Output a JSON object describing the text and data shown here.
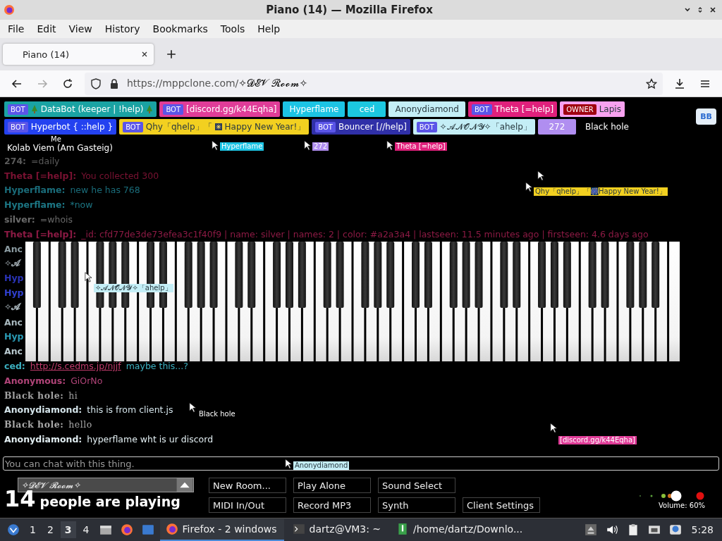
{
  "window": {
    "title": "Piano (14) — Mozilla Firefox"
  },
  "menu": [
    "File",
    "Edit",
    "View",
    "History",
    "Bookmarks",
    "Tools",
    "Help"
  ],
  "tabs": [
    {
      "label": "Piano (14)",
      "selected": true
    }
  ],
  "address": {
    "host": "https://mppclone.com/",
    "path": "✧𝓓𝓔𝓥 𝓡𝓸𝓸𝓶✧"
  },
  "player_rows": [
    [
      {
        "kind": "bot",
        "badge": "BOT",
        "parts": [
          {
            "kind": "tree"
          },
          {
            "kind": "text",
            "text": "DataBot (keeper | !help)"
          },
          {
            "kind": "tree"
          }
        ],
        "color": "#1aa3a3"
      },
      {
        "kind": "bot",
        "badge": "BOT",
        "name": "[discord.gg/k44Eqha]",
        "color": "#e03c98"
      },
      {
        "kind": "plain",
        "name": "Hyperflame",
        "color": "#1cc4e4"
      },
      {
        "kind": "plain",
        "name": "ced",
        "color": "#1cc8e0"
      },
      {
        "kind": "plain",
        "name": "Anonydiamond",
        "color": "#c4eef6"
      },
      {
        "kind": "bot",
        "badge": "BOT",
        "name": "Theta [=help]",
        "color": "#e0207c"
      },
      {
        "kind": "owner",
        "badge": "OWNER",
        "name": "Lapis",
        "color": "#f8a2f0"
      }
    ],
    [
      {
        "kind": "bot",
        "badge": "BOT",
        "name": "Hyperbot { ::help }",
        "color": "#2442f0"
      },
      {
        "kind": "bot",
        "badge": "BOT",
        "parts": [
          {
            "kind": "text",
            "text": "Qhy「qhelp」「"
          },
          {
            "kind": "firework"
          },
          {
            "kind": "text",
            "text": "Happy New Year!」"
          }
        ],
        "color": "#f2d020"
      },
      {
        "kind": "bot",
        "badge": "BOT",
        "name": "Bouncer [//help]",
        "color": "#3030a8"
      },
      {
        "kind": "bot",
        "badge": "BOT",
        "name": "✧𝓐𝓝𝓞𝓝𝓨✧「ahelp」",
        "color": "#c4eef6"
      },
      {
        "kind": "plain",
        "name": "272",
        "color": "#b08ef0"
      },
      {
        "kind": "plain",
        "name": "Black hole",
        "color": "#000000"
      }
    ]
  ],
  "corner_badge": "BB",
  "status_text": "Kolab Viem (Am Gasteig)",
  "chat": [
    {
      "kind": "normal",
      "name": "274:",
      "text": "=daily",
      "color": "#5a5a5a"
    },
    {
      "kind": "normal",
      "name": "Theta [=help]:",
      "text": "You collected 300",
      "color": "#7a1232"
    },
    {
      "kind": "normal",
      "name": "Hyperflame:",
      "text": "new he has 768",
      "color": "#1a6c7a"
    },
    {
      "kind": "normal",
      "name": "Hyperflame:",
      "text": "*now",
      "color": "#1c7684"
    },
    {
      "kind": "normal",
      "name": "silver:",
      "text": "=whois",
      "color": "#6a6a6a"
    },
    {
      "kind": "normal",
      "name": "Theta [=help]:",
      "text": "_id: cfd77de3de73efea3c1f40f9 | name: silver | names: 2 | color: #a2a3a4 | lastseen: 11.5 minutes ago | firstseen: 4.6 days ago",
      "color": "#8c1a44"
    },
    {
      "kind": "normal",
      "name": "Anc",
      "color": "#8a9aa0"
    },
    {
      "kind": "normal",
      "name": "✧𝓐",
      "color": "#9aa4aa"
    },
    {
      "kind": "normal",
      "name": "Hyp",
      "color": "#2a34b8"
    },
    {
      "kind": "normal",
      "name": "Hyp",
      "color": "#3040d0"
    },
    {
      "kind": "normal",
      "name": "✧𝓐",
      "color": "#a8b4ba"
    },
    {
      "kind": "normal",
      "name": "Anc",
      "color": "#a8b8be"
    },
    {
      "kind": "normal",
      "name": "Hyp",
      "color": "#2a9ab4"
    },
    {
      "kind": "normal",
      "name": "Anc",
      "color": "#b8c8ce"
    },
    {
      "kind": "normal",
      "name": "ced:",
      "link": "http://s.cedms.jp/njjf",
      "text": "maybe this...?",
      "color": "#3cb0c0"
    },
    {
      "kind": "normal",
      "name": "Anonymous:",
      "text": "GiOrNo",
      "color": "#b04478"
    },
    {
      "kind": "outline",
      "name": "Black hole:",
      "text": "hi",
      "color": "#a0a0a0"
    },
    {
      "kind": "normal",
      "name": "Anonydiamond:",
      "text": "this is from client.js",
      "color": "#d4e4ea"
    },
    {
      "kind": "outline",
      "name": "Black hole:",
      "text": "hello",
      "color": "#a8a8a8"
    },
    {
      "kind": "normal",
      "name": "Anonydiamond:",
      "text": "hyperflame wht is ur discord",
      "color": "#e2eef2"
    }
  ],
  "cursors": [
    {
      "label": "Me",
      "color": "#000000"
    },
    {
      "label": "Hyperflame",
      "color": "#1cc4e4"
    },
    {
      "label": "272",
      "color": "#b08ef0"
    },
    {
      "label": "Theta [=help]",
      "color": "#e0207c"
    },
    {
      "label": "Qhy「qhelp」「🎆Happy New Year!」",
      "color": "#f2d020"
    },
    {
      "label": "✧𝓐𝓝𝓞𝓝𝓨✧「ahelp」",
      "color": "#c4eef6"
    },
    {
      "label": "Black hole",
      "color": "#000000"
    },
    {
      "label": "Anonydiamond",
      "color": "#c4eef6"
    },
    {
      "label": "[discord.gg/k44Eqha]",
      "color": "#e03c98"
    }
  ],
  "chat_input": {
    "placeholder": "You can chat with this thing."
  },
  "room": {
    "name": "✧𝓓𝓔𝓥 𝓡𝓸𝓸𝓶✧"
  },
  "player_count": {
    "count": "14",
    "label": "people are playing"
  },
  "buttons": [
    [
      "New Room...",
      "Play Alone",
      "Sound Select"
    ],
    [
      "MIDI In/Out",
      "Record MP3",
      "Synth",
      "Client Settings"
    ]
  ],
  "volume": {
    "label": "Volume: 60%"
  },
  "taskbar": {
    "workspaces": [
      {
        "label": "1",
        "selected": false
      },
      {
        "label": "2",
        "selected": false
      },
      {
        "label": "3",
        "selected": true
      },
      {
        "label": "4",
        "selected": false
      }
    ],
    "windows": [
      {
        "label": "Firefox - 2 windows",
        "kind": "firefox",
        "selected": true
      },
      {
        "label": "dartz@VM3: ~",
        "kind": "terminal",
        "selected": false
      },
      {
        "label": "/home/dartz/Downlo...",
        "kind": "folder",
        "selected": false
      }
    ],
    "clock": "5:28"
  }
}
